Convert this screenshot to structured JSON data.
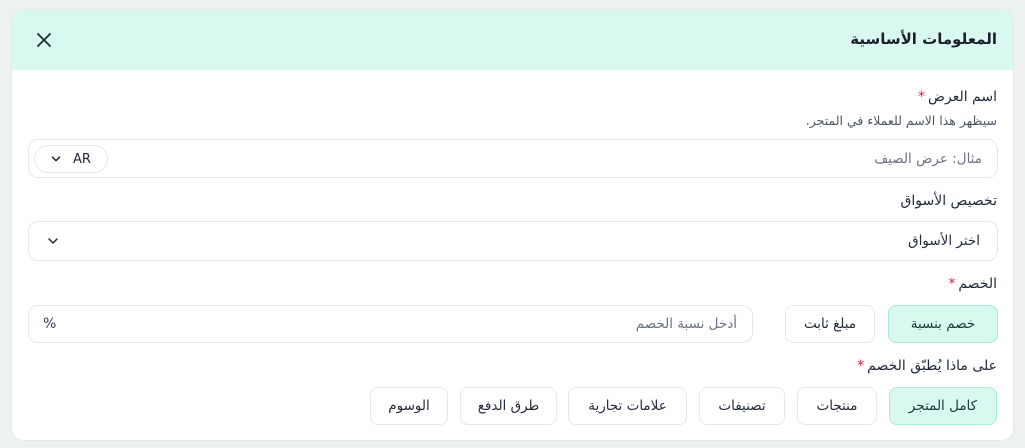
{
  "header": {
    "title": "المعلومات الأساسية",
    "close_icon": "close-icon"
  },
  "offer_name": {
    "label": "اسم العرض",
    "required_mark": "*",
    "hint": "سيظهر هذا الاسم للعملاء في المتجر.",
    "placeholder": "مثال: عرض الصيف",
    "language": "AR"
  },
  "markets": {
    "label": "تخصيص الأسواق",
    "selected": "اختر الأسواق"
  },
  "discount": {
    "label": "الخصم",
    "required_mark": "*",
    "types": [
      {
        "label": "خصم بنسبة",
        "active": true
      },
      {
        "label": "مبلغ ثابت",
        "active": false
      }
    ],
    "placeholder": "أدخل نسبة الخصم",
    "unit": "%"
  },
  "applies_to": {
    "label": "على ماذا يُطبّق الخصم",
    "required_mark": "*",
    "options": [
      {
        "label": "كامل المتجر",
        "active": true
      },
      {
        "label": "منتجات",
        "active": false
      },
      {
        "label": "تصنيفات",
        "active": false
      },
      {
        "label": "علامات تجارية",
        "active": false
      },
      {
        "label": "طرق الدفع",
        "active": false
      },
      {
        "label": "الوسوم",
        "active": false
      }
    ]
  },
  "colors": {
    "accent_bg": "#d9f8f0",
    "accent_border": "#a7ecd9",
    "required": "#e11d48"
  }
}
